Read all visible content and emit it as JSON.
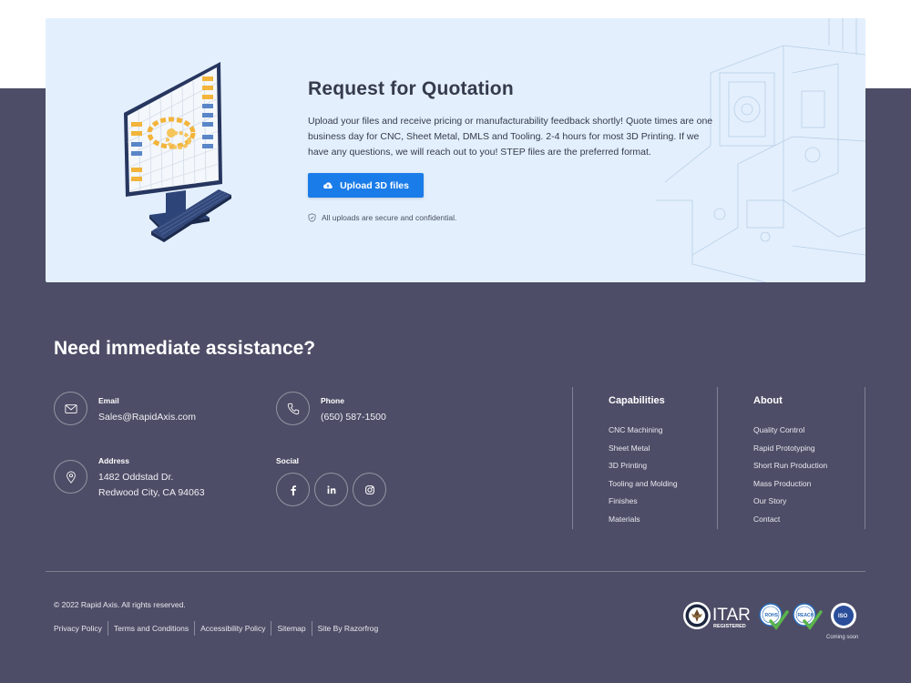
{
  "rfq": {
    "title": "Request for Quotation",
    "description": "Upload your files and receive pricing or manufacturability feedback shortly! Quote times are one business day for CNC, Sheet Metal, DMLS and Tooling. 2-4 hours for most 3D Printing. If we have any questions, we will reach out to you! STEP files are the preferred format.",
    "upload_label": "Upload 3D files",
    "secure_note": "All uploads are secure and confidential.",
    "colors": {
      "card_bg": "#e3effc",
      "button": "#1a7ce8"
    }
  },
  "footer": {
    "assist_title": "Need immediate assistance?",
    "email": {
      "label": "Email",
      "value": "Sales@RapidAxis.com"
    },
    "phone": {
      "label": "Phone",
      "value": "(650) 587-1500"
    },
    "address": {
      "label": "Address",
      "line1": "1482 Oddstad Dr.",
      "line2": "Redwood City, CA 94063"
    },
    "social": {
      "label": "Social",
      "icons": [
        "facebook-icon",
        "linkedin-icon",
        "instagram-icon"
      ]
    },
    "capabilities": {
      "title": "Capabilities",
      "links": [
        "CNC Machining",
        "Sheet Metal",
        "3D Printing",
        "Tooling and Molding",
        "Finishes",
        "Materials"
      ]
    },
    "about": {
      "title": "About",
      "links": [
        "Quality Control",
        "Rapid Prototyping",
        "Short Run Production",
        "Mass Production",
        "Our Story",
        "Contact"
      ]
    },
    "copyright": "© 2022 Rapid Axis. All rights reserved.",
    "legal_links": [
      "Privacy Policy",
      "Terms and Conditions",
      "Accessibility Policy",
      "Sitemap",
      "Site By Razorfrog"
    ],
    "badges": {
      "itar_main": "ITAR",
      "itar_sub": "REGISTERED",
      "rohs": "ROHS",
      "reach": "REACH",
      "iso": "ISO",
      "coming_soon": "Coming soon"
    },
    "colors": {
      "bg": "#4d4d67"
    }
  }
}
